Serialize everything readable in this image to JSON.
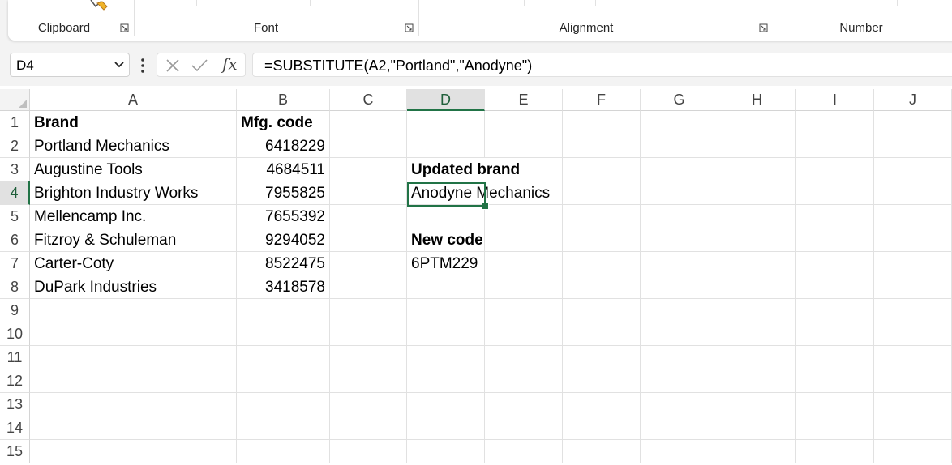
{
  "ribbon": {
    "groups": [
      "Clipboard",
      "Font",
      "Alignment",
      "Number"
    ]
  },
  "formula_bar": {
    "name_box": "D4",
    "fx_label": "fx",
    "formula": "=SUBSTITUTE(A2,\"Portland\",\"Anodyne\")"
  },
  "grid": {
    "columns": [
      "A",
      "B",
      "C",
      "D",
      "E",
      "F",
      "G",
      "H",
      "I",
      "J"
    ],
    "rows": [
      "1",
      "2",
      "3",
      "4",
      "5",
      "6",
      "7",
      "8",
      "9",
      "10",
      "11",
      "12",
      "13",
      "14",
      "15"
    ],
    "active_column": "D",
    "active_row": "4",
    "accent_color": "#217346"
  },
  "cells": {
    "A1": "Brand",
    "B1": "Mfg. code",
    "A2": "Portland Mechanics",
    "B2": "6418229",
    "A3": "Augustine Tools",
    "B3": "4684511",
    "A4": "Brighton Industry Works",
    "B4": "7955825",
    "A5": "Mellencamp Inc.",
    "B5": "7655392",
    "A6": "Fitzroy & Schuleman",
    "B6": "9294052",
    "A7": "Carter-Coty",
    "B7": "8522475",
    "A8": "DuPark Industries",
    "B8": "3418578",
    "D3": "Updated brand",
    "D4": "Anodyne Mechanics",
    "D6": "New code",
    "D7": "6PTM229"
  }
}
